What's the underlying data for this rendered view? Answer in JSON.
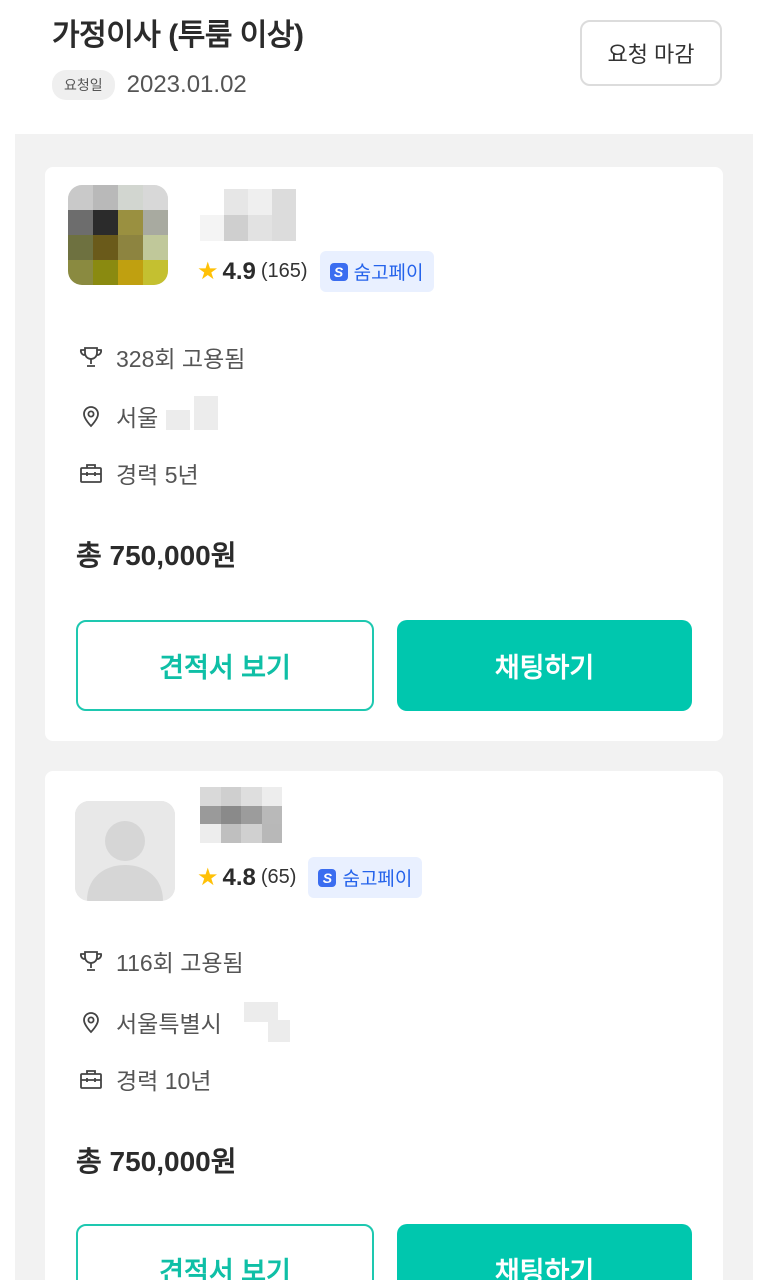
{
  "header": {
    "title": "가정이사 (투룸 이상)",
    "request_badge": "요청일",
    "request_date": "2023.01.02",
    "close_button": "요청 마감"
  },
  "cards": [
    {
      "rating": "4.9",
      "review_count": "(165)",
      "pay_label": "숨고페이",
      "hires": "328회 고용됨",
      "location": "서울",
      "career": "경력 5년",
      "price": "총 750,000원",
      "quote_button": "견적서 보기",
      "chat_button": "채팅하기"
    },
    {
      "rating": "4.8",
      "review_count": "(65)",
      "pay_label": "숨고페이",
      "hires": "116회 고용됨",
      "location": "서울특별시",
      "career": "경력 10년",
      "price": "총 750,000원",
      "quote_button": "견적서 보기",
      "chat_button": "채팅하기"
    }
  ],
  "colors": {
    "accent": "#00c7ae",
    "star": "#ffc107",
    "pay_badge_text": "#2563eb"
  }
}
